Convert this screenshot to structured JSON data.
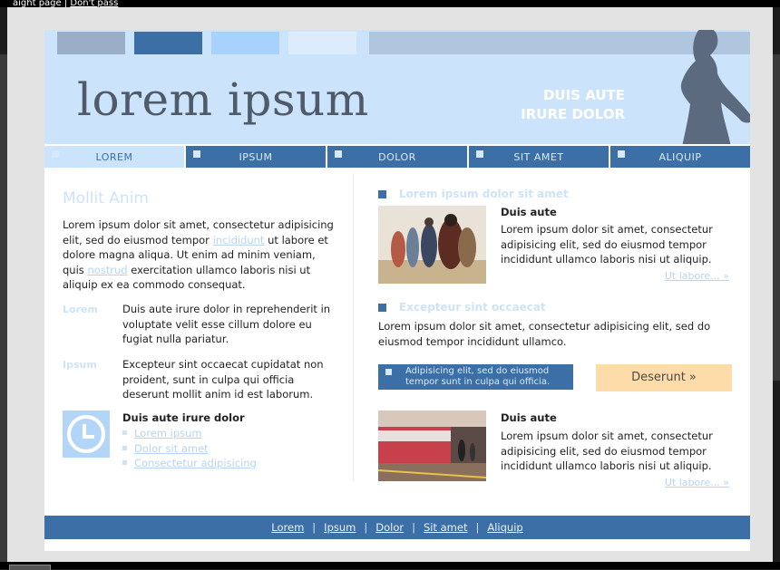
{
  "topline": {
    "prefix": "aight page |",
    "link": "Don't pass"
  },
  "header": {
    "logo": "lorem ipsum",
    "tagline_1": "DUIS AUTE",
    "tagline_2": "IRURE DOLOR",
    "swatch_colors": [
      "#9aaec7",
      "#3c6fa6",
      "#a8d2fb",
      "#dcecfd",
      "#b0c6de"
    ]
  },
  "nav": {
    "items": [
      {
        "label": "LOREM",
        "active": true
      },
      {
        "label": "IPSUM"
      },
      {
        "label": "DOLOR"
      },
      {
        "label": "SIT AMET"
      },
      {
        "label": "ALIQUIP"
      }
    ]
  },
  "left": {
    "title": "Mollit Anim",
    "intro_1": "Lorem ipsum dolor sit amet, consectetur adipisicing elit, sed do eiusmod tempor",
    "intro_link_1": "incididunt",
    "intro_2": "ut labore et dolore magna aliqua. Ut enim ad minim veniam, quis",
    "intro_link_2": "nostrud",
    "intro_3": "exercitation ullamco laboris nisi ut aliquip ex ea commodo consequat.",
    "terms": [
      {
        "label": "Lorem",
        "text": "Duis aute irure dolor in reprehenderit in voluptate velit esse cillum dolore eu fugiat nulla pariatur."
      },
      {
        "label": "Ipsum",
        "text": "Excepteur sint occaecat cupidatat non proident, sunt in culpa qui officia deserunt mollit anim id est laborum."
      }
    ],
    "sub_title": "Duis aute irure dolor",
    "sub_links": [
      "Lorem ipsum",
      "Dolor sit amet",
      "Consectetur adipisicing"
    ]
  },
  "right": {
    "section1_title": "Lorem ipsum dolor sit amet",
    "article1": {
      "title": "Duis aute",
      "text": "Lorem ipsum dolor sit amet, consectetur adipisicing elit, sed do eiusmod tempor incididunt ullamco laboris nisi ut aliquip.",
      "more": "Ut labore... »"
    },
    "section2_title": "Excepteur sint occaecat",
    "section2_text": "Lorem ipsum dolor sit amet, consectetur adipisicing elit, sed do eiusmod tempor incididunt ullamco.",
    "blue_box": "Adipisicing elit, sed do eiusmod tempor sunt in culpa qui officia.",
    "button": "Deserunt »",
    "article2": {
      "title": "Duis aute",
      "text": "Lorem ipsum dolor sit amet, consectetur adipisicing elit, sed do eiusmod tempor incididunt ullamco laboris nisi ut aliquip.",
      "more": "Ut labore... »"
    }
  },
  "footer": {
    "links": [
      "Lorem",
      "Ipsum",
      "Dolor",
      "Sit amet",
      "Aliquip"
    ],
    "separator": "|"
  },
  "colors": {
    "accent_blue": "#3c6fa6",
    "header_bg": "#cce4fb",
    "button_bg": "#fddcaa",
    "light_text": "#cfe3f7"
  }
}
